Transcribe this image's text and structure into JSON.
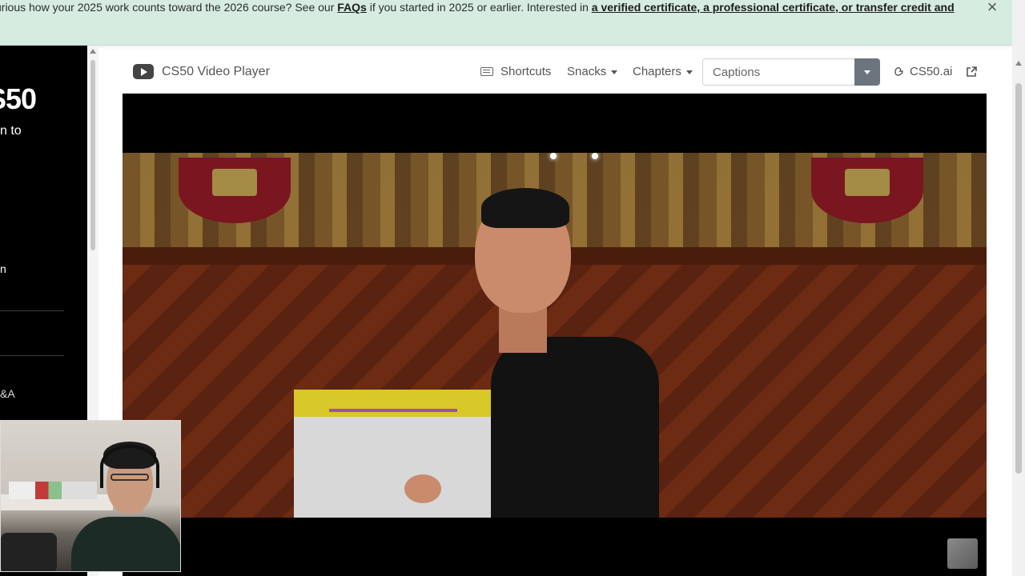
{
  "banner": {
    "text_start": "urious how your 2025 work counts toward the 2026 course? See our ",
    "faq_link": "FAQs",
    "text_mid": " if you started in 2025 or earlier. Interested in ",
    "cert_link": "a verified certificate, a professional certificate, or transfer credit and"
  },
  "sidebar": {
    "title": "S50",
    "subtitle": "n to",
    "mark": "n",
    "qa": "&A"
  },
  "player": {
    "title": "CS50 Video Player",
    "shortcuts": "Shortcuts",
    "snacks": "Snacks",
    "chapters": "Chapters",
    "captions_placeholder": "Captions",
    "ai_link": "CS50.ai"
  },
  "icons": {
    "youtube": "youtube-icon",
    "keyboard": "keyboard-icon",
    "duck": "duck-icon",
    "external": "external-link-icon",
    "close": "close-icon"
  }
}
